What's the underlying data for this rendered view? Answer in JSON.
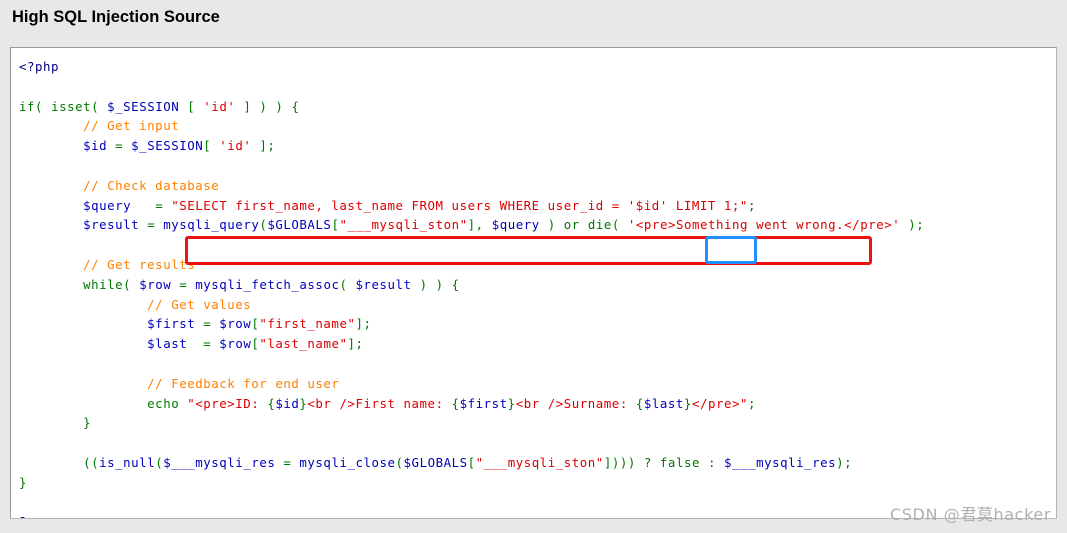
{
  "page": {
    "title": "High SQL Injection Source",
    "background_color": "#e8e8e8"
  },
  "code_panel": {
    "language": "php",
    "background_color": "#ffffff",
    "border_color": "#b5b5b5",
    "lines": [
      "<?php",
      "",
      "if( isset( $_SESSION [ 'id' ] ) ) {",
      "        // Get input",
      "        $id = $_SESSION[ 'id' ];",
      "",
      "        // Check database",
      "        $query  = \"SELECT first_name, last_name FROM users WHERE user_id = '$id' LIMIT 1;\";",
      "        $result = mysqli_query($GLOBALS[\"___mysqli_ston\"],  $query ) or die( '<pre>Something went wrong.</pre>' );",
      "",
      "        // Get results",
      "        while( $row = mysqli_fetch_assoc( $result ) ) {",
      "                // Get values",
      "                $first = $row[\"first_name\"];",
      "                $last  = $row[\"last_name\"];",
      "",
      "                // Feedback for end user",
      "                echo \"<pre>ID: {$id}<br />First name: {$first}<br />Surname: {$last}</pre>\";",
      "        }",
      "",
      "        ((is_null($___mysqli_res = mysqli_close($GLOBALS[\"___mysqli_ston\"]))) ? false : $___mysqli_res);",
      "}",
      "",
      "?>"
    ],
    "syntax_colors": {
      "tag": "#000080",
      "keyword": "#007700",
      "variable": "#0000bb",
      "string": "#dd0000",
      "comment": "#ff8000"
    }
  },
  "annotations": {
    "query_highlight": {
      "label": "SQL query statement highlight",
      "color": "#ee1111",
      "target_text": "\"SELECT first_name, last_name FROM users WHERE user_id = '$id' LIMIT 1;\";"
    },
    "id_highlight": {
      "label": "quoted id parameter highlight",
      "color": "#1e90ff",
      "target_text": "'$id'"
    }
  },
  "watermark": {
    "text": "CSDN @君莫hacker",
    "color": "#b0b0b0"
  }
}
